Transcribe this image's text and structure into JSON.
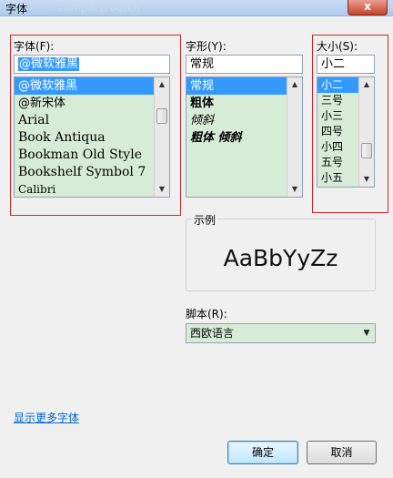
{
  "window": {
    "title": "字体",
    "title_ghost": "...compare/batch",
    "close_label": "x"
  },
  "font": {
    "label": "字体(F):",
    "input_value": "@微软雅黑",
    "items": [
      "@微软雅黑",
      "@新宋体",
      "Arial",
      "Book Antiqua",
      "Bookman Old Style",
      "Bookshelf Symbol 7",
      "Calibri"
    ]
  },
  "style": {
    "label": "字形(Y):",
    "input_value": "常规",
    "items": [
      "常规",
      "粗体",
      "倾斜",
      "粗体 倾斜"
    ]
  },
  "size": {
    "label": "大小(S):",
    "input_value": "小二",
    "items": [
      "小二",
      "三号",
      "小三",
      "四号",
      "小四",
      "五号",
      "小五"
    ]
  },
  "preview": {
    "legend": "示例",
    "sample": "AaBbYyZz"
  },
  "script": {
    "label": "脚本(R):",
    "value": "西欧语言"
  },
  "links": {
    "more_fonts": "显示更多字体"
  },
  "buttons": {
    "ok": "确定",
    "cancel": "取消"
  },
  "icons": {
    "scroll_up": "▲",
    "scroll_down": "▼",
    "combo_arrow": "▼"
  }
}
